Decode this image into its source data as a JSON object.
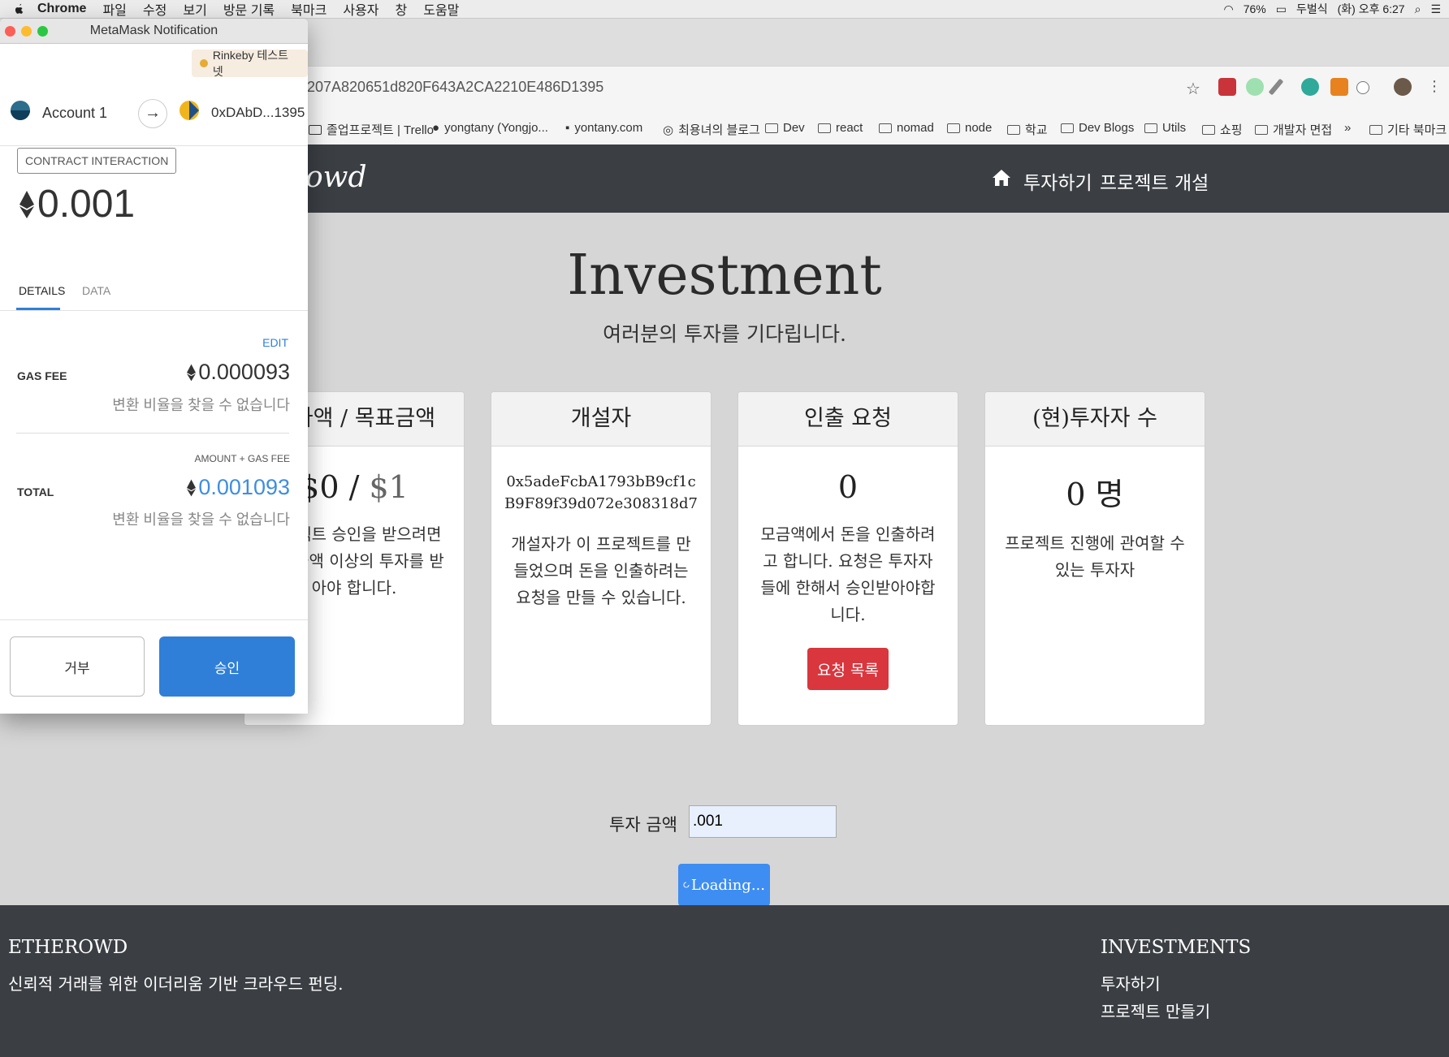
{
  "menubar": {
    "app": "Chrome",
    "items": [
      "파일",
      "수정",
      "보기",
      "방문 기록",
      "북마크",
      "사용자",
      "창",
      "도움말"
    ],
    "battery": "76%",
    "input_method": "두벌식",
    "clock": "(화) 오후 6:27"
  },
  "browser": {
    "url": "207A820651d820F643A2CA2210E486D1395",
    "bookmarks": [
      "졸업프로젝트 | Trello",
      "yongtany (Yongjo...",
      "yontany.com",
      "최용녀의 블로그",
      "Dev",
      "react",
      "nomad",
      "node",
      "학교",
      "Dev Blogs",
      "Utils",
      "쇼핑",
      "개발자 면접",
      "»",
      "기타 북마크"
    ]
  },
  "site": {
    "brand_partial": "owd",
    "nav": {
      "invest": "투자하기",
      "create": "프로젝트 개설"
    },
    "hero": {
      "title": "Investment",
      "subtitle": "여러분의 투자를 기다립니다."
    },
    "cards": [
      {
        "title": "투자액 / 목표금액",
        "value_current": "$0",
        "value_sep": " / ",
        "value_target": "$1",
        "desc": "프로젝트 승인을 받으려면 목표금액 이상의 투자를 받아야 합니다."
      },
      {
        "title": "개설자",
        "address": "0x5adeFcbA1793bB9cf1cB9F89f39d072e308318d7",
        "desc": "개설자가 이 프로젝트를 만들었으며 돈을 인출하려는 요청을 만들 수 있습니다."
      },
      {
        "title": "인출 요청",
        "value": "0",
        "desc": "모금액에서 돈을 인출하려고 합니다. 요청은 투자자들에 한해서 승인받아야합니다.",
        "button": "요청 목록"
      },
      {
        "title": "(현)투자자 수",
        "value": "0 명",
        "desc": "프로젝트 진행에 관여할 수 있는 투자자"
      }
    ],
    "form": {
      "label": "투자 금액",
      "value": ".001",
      "button": "Loading..."
    },
    "footer": {
      "brand": "ETHEROWD",
      "tagline": "신뢰적 거래를 위한 이더리움 기반 크라우드 펀딩.",
      "section_title": "INVESTMENTS",
      "links": [
        "투자하기",
        "프로젝트 만들기"
      ]
    }
  },
  "metamask": {
    "window_title": "MetaMask Notification",
    "network": "Rinkeby 테스트넷",
    "from_account": "Account 1",
    "to_address": "0xDAbD...1395",
    "badge": "CONTRACT INTERACTION",
    "amount": "0.001",
    "tabs": [
      "DETAILS",
      "DATA"
    ],
    "edit": "EDIT",
    "gas_label": "GAS FEE",
    "gas_value": "0.000093",
    "gas_note": "변환 비율을 찾을 수 없습니다",
    "total_sublabel": "AMOUNT + GAS FEE",
    "total_label": "TOTAL",
    "total_value": "0.001093",
    "total_note": "변환 비율을 찾을 수 없습니다",
    "reject": "거부",
    "approve": "승인"
  },
  "colors": {
    "nav_bg": "#3b3f44",
    "accent_blue": "#2f7fd8",
    "danger_red": "#d9363e",
    "loading_blue": "#3e8df2"
  }
}
